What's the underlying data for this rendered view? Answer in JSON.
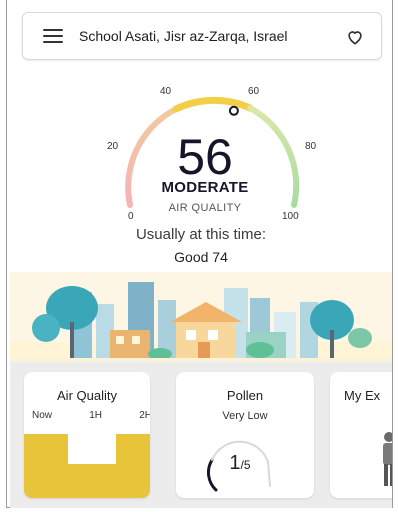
{
  "header": {
    "location": "School Asati, Jisr az-Zarqa, Israel",
    "menu_icon": "hamburger-menu-icon",
    "favorite_icon": "heart-outline-icon"
  },
  "gauge": {
    "value": 56,
    "value_text": "56",
    "min": 0,
    "max": 100,
    "status": "MODERATE",
    "label": "AIR QUALITY",
    "ticks": [
      "0",
      "20",
      "40",
      "60",
      "80",
      "100"
    ],
    "colors": {
      "poor": "#f2a6a6",
      "moderate": "#f3cf47",
      "good": "#a8dba0",
      "text": "#15162a"
    }
  },
  "usual": {
    "label": "Usually at this time:",
    "value": "Good 74"
  },
  "cards": {
    "air_quality": {
      "title": "Air Quality",
      "tabs": [
        "Now",
        "1H",
        "2H"
      ],
      "bar_color": "#e8c43a"
    },
    "pollen": {
      "title": "Pollen",
      "level": "Very Low",
      "value": "1",
      "max": "/5"
    },
    "exposure": {
      "title": "My Ex"
    }
  }
}
